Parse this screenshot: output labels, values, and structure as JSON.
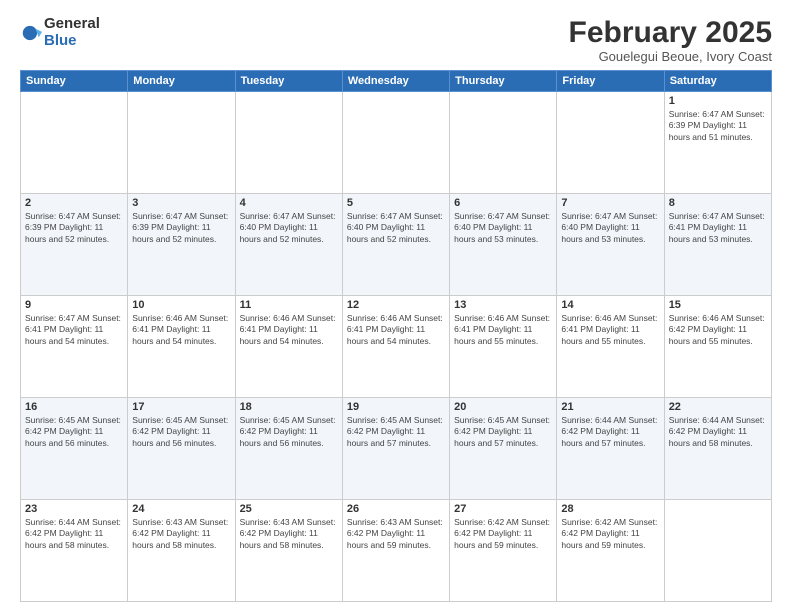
{
  "logo": {
    "general": "General",
    "blue": "Blue"
  },
  "title": "February 2025",
  "subtitle": "Gouelegui Beoue, Ivory Coast",
  "weekdays": [
    "Sunday",
    "Monday",
    "Tuesday",
    "Wednesday",
    "Thursday",
    "Friday",
    "Saturday"
  ],
  "weeks": [
    [
      {
        "day": "",
        "info": ""
      },
      {
        "day": "",
        "info": ""
      },
      {
        "day": "",
        "info": ""
      },
      {
        "day": "",
        "info": ""
      },
      {
        "day": "",
        "info": ""
      },
      {
        "day": "",
        "info": ""
      },
      {
        "day": "1",
        "info": "Sunrise: 6:47 AM\nSunset: 6:39 PM\nDaylight: 11 hours and 51 minutes."
      }
    ],
    [
      {
        "day": "2",
        "info": "Sunrise: 6:47 AM\nSunset: 6:39 PM\nDaylight: 11 hours and 52 minutes."
      },
      {
        "day": "3",
        "info": "Sunrise: 6:47 AM\nSunset: 6:39 PM\nDaylight: 11 hours and 52 minutes."
      },
      {
        "day": "4",
        "info": "Sunrise: 6:47 AM\nSunset: 6:40 PM\nDaylight: 11 hours and 52 minutes."
      },
      {
        "day": "5",
        "info": "Sunrise: 6:47 AM\nSunset: 6:40 PM\nDaylight: 11 hours and 52 minutes."
      },
      {
        "day": "6",
        "info": "Sunrise: 6:47 AM\nSunset: 6:40 PM\nDaylight: 11 hours and 53 minutes."
      },
      {
        "day": "7",
        "info": "Sunrise: 6:47 AM\nSunset: 6:40 PM\nDaylight: 11 hours and 53 minutes."
      },
      {
        "day": "8",
        "info": "Sunrise: 6:47 AM\nSunset: 6:41 PM\nDaylight: 11 hours and 53 minutes."
      }
    ],
    [
      {
        "day": "9",
        "info": "Sunrise: 6:47 AM\nSunset: 6:41 PM\nDaylight: 11 hours and 54 minutes."
      },
      {
        "day": "10",
        "info": "Sunrise: 6:46 AM\nSunset: 6:41 PM\nDaylight: 11 hours and 54 minutes."
      },
      {
        "day": "11",
        "info": "Sunrise: 6:46 AM\nSunset: 6:41 PM\nDaylight: 11 hours and 54 minutes."
      },
      {
        "day": "12",
        "info": "Sunrise: 6:46 AM\nSunset: 6:41 PM\nDaylight: 11 hours and 54 minutes."
      },
      {
        "day": "13",
        "info": "Sunrise: 6:46 AM\nSunset: 6:41 PM\nDaylight: 11 hours and 55 minutes."
      },
      {
        "day": "14",
        "info": "Sunrise: 6:46 AM\nSunset: 6:41 PM\nDaylight: 11 hours and 55 minutes."
      },
      {
        "day": "15",
        "info": "Sunrise: 6:46 AM\nSunset: 6:42 PM\nDaylight: 11 hours and 55 minutes."
      }
    ],
    [
      {
        "day": "16",
        "info": "Sunrise: 6:45 AM\nSunset: 6:42 PM\nDaylight: 11 hours and 56 minutes."
      },
      {
        "day": "17",
        "info": "Sunrise: 6:45 AM\nSunset: 6:42 PM\nDaylight: 11 hours and 56 minutes."
      },
      {
        "day": "18",
        "info": "Sunrise: 6:45 AM\nSunset: 6:42 PM\nDaylight: 11 hours and 56 minutes."
      },
      {
        "day": "19",
        "info": "Sunrise: 6:45 AM\nSunset: 6:42 PM\nDaylight: 11 hours and 57 minutes."
      },
      {
        "day": "20",
        "info": "Sunrise: 6:45 AM\nSunset: 6:42 PM\nDaylight: 11 hours and 57 minutes."
      },
      {
        "day": "21",
        "info": "Sunrise: 6:44 AM\nSunset: 6:42 PM\nDaylight: 11 hours and 57 minutes."
      },
      {
        "day": "22",
        "info": "Sunrise: 6:44 AM\nSunset: 6:42 PM\nDaylight: 11 hours and 58 minutes."
      }
    ],
    [
      {
        "day": "23",
        "info": "Sunrise: 6:44 AM\nSunset: 6:42 PM\nDaylight: 11 hours and 58 minutes."
      },
      {
        "day": "24",
        "info": "Sunrise: 6:43 AM\nSunset: 6:42 PM\nDaylight: 11 hours and 58 minutes."
      },
      {
        "day": "25",
        "info": "Sunrise: 6:43 AM\nSunset: 6:42 PM\nDaylight: 11 hours and 58 minutes."
      },
      {
        "day": "26",
        "info": "Sunrise: 6:43 AM\nSunset: 6:42 PM\nDaylight: 11 hours and 59 minutes."
      },
      {
        "day": "27",
        "info": "Sunrise: 6:42 AM\nSunset: 6:42 PM\nDaylight: 11 hours and 59 minutes."
      },
      {
        "day": "28",
        "info": "Sunrise: 6:42 AM\nSunset: 6:42 PM\nDaylight: 11 hours and 59 minutes."
      },
      {
        "day": "",
        "info": ""
      }
    ]
  ]
}
